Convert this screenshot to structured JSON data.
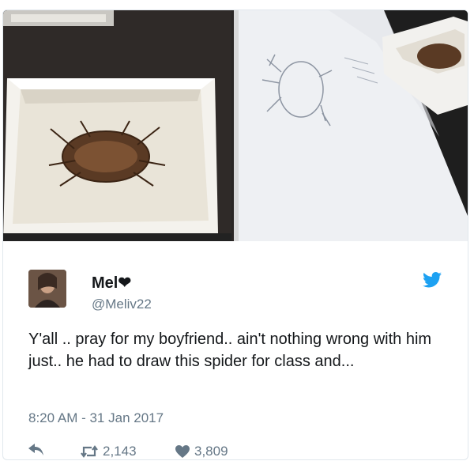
{
  "tweet": {
    "display_name": "Mel❤",
    "handle": "@Meliv22",
    "text": "Y'all .. pray for my boyfriend.. ain't nothing wrong with him just.. he had to draw this spider for class and...",
    "timestamp": "8:20 AM - 31 Jan 2017"
  },
  "actions": {
    "retweets": "2,143",
    "likes": "3,809"
  },
  "icons": {
    "reply": "reply-icon",
    "retweet": "retweet-icon",
    "like": "heart-icon",
    "brand": "twitter-bird-icon"
  },
  "colors": {
    "brand": "#1da1f2",
    "secondary_text": "#657786",
    "primary_text": "#14171a"
  }
}
